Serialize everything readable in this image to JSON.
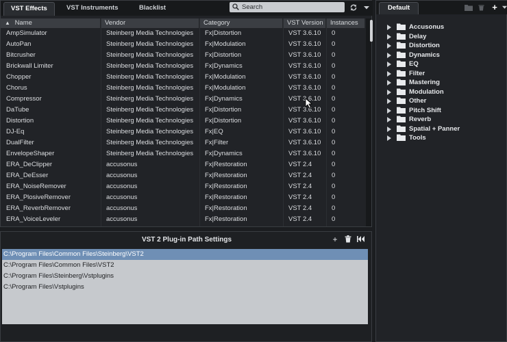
{
  "left_tabs": [
    "VST Effects",
    "VST Instruments",
    "Blacklist"
  ],
  "search": {
    "placeholder": "Search"
  },
  "toolbar": {
    "refresh_icon": "refresh-icon",
    "menu_icon": "dropdown-icon"
  },
  "table": {
    "sort_indicator": "▲",
    "columns": [
      "Name",
      "Vendor",
      "Category",
      "VST Version",
      "Instances"
    ],
    "rows": [
      [
        "AmpSimulator",
        "Steinberg Media Technologies",
        "Fx|Distortion",
        "VST 3.6.10",
        "0"
      ],
      [
        "AutoPan",
        "Steinberg Media Technologies",
        "Fx|Modulation",
        "VST 3.6.10",
        "0"
      ],
      [
        "Bitcrusher",
        "Steinberg Media Technologies",
        "Fx|Distortion",
        "VST 3.6.10",
        "0"
      ],
      [
        "Brickwall Limiter",
        "Steinberg Media Technologies",
        "Fx|Dynamics",
        "VST 3.6.10",
        "0"
      ],
      [
        "Chopper",
        "Steinberg Media Technologies",
        "Fx|Modulation",
        "VST 3.6.10",
        "0"
      ],
      [
        "Chorus",
        "Steinberg Media Technologies",
        "Fx|Modulation",
        "VST 3.6.10",
        "0"
      ],
      [
        "Compressor",
        "Steinberg Media Technologies",
        "Fx|Dynamics",
        "VST 3.6.10",
        "0"
      ],
      [
        "DaTube",
        "Steinberg Media Technologies",
        "Fx|Distortion",
        "VST 3.6.10",
        "0"
      ],
      [
        "Distortion",
        "Steinberg Media Technologies",
        "Fx|Distortion",
        "VST 3.6.10",
        "0"
      ],
      [
        "DJ-Eq",
        "Steinberg Media Technologies",
        "Fx|EQ",
        "VST 3.6.10",
        "0"
      ],
      [
        "DualFilter",
        "Steinberg Media Technologies",
        "Fx|Filter",
        "VST 3.6.10",
        "0"
      ],
      [
        "EnvelopeShaper",
        "Steinberg Media Technologies",
        "Fx|Dynamics",
        "VST 3.6.10",
        "0"
      ],
      [
        "ERA_DeClipper",
        "accusonus",
        "Fx|Restoration",
        "VST 2.4",
        "0"
      ],
      [
        "ERA_DeEsser",
        "accusonus",
        "Fx|Restoration",
        "VST 2.4",
        "0"
      ],
      [
        "ERA_NoiseRemover",
        "accusonus",
        "Fx|Restoration",
        "VST 2.4",
        "0"
      ],
      [
        "ERA_PlosiveRemover",
        "accusonus",
        "Fx|Restoration",
        "VST 2.4",
        "0"
      ],
      [
        "ERA_ReverbRemover",
        "accusonus",
        "Fx|Restoration",
        "VST 2.4",
        "0"
      ],
      [
        "ERA_VoiceLeveler",
        "accusonus",
        "Fx|Restoration",
        "VST 2.4",
        "0"
      ]
    ]
  },
  "path_settings": {
    "title": "VST 2 Plug-in Path Settings",
    "paths": [
      "C:\\Program Files\\Common Files\\Steinberg\\VST2",
      "C:\\Program Files\\Common Files\\VST2",
      "C:\\Program Files\\Steinberg\\Vstplugins",
      "C:\\Program Files\\Vstplugins"
    ],
    "selected_index": 0,
    "icons": [
      "add-icon",
      "trash-icon",
      "reset-icon"
    ]
  },
  "right_panel": {
    "tab": "Default",
    "icons": [
      "new-folder-icon",
      "trash-icon",
      "add-icon",
      "dropdown-icon"
    ],
    "folders": [
      "Accusonus",
      "Delay",
      "Distortion",
      "Dynamics",
      "EQ",
      "Filter",
      "Mastering",
      "Modulation",
      "Other",
      "Pitch Shift",
      "Reverb",
      "Spatial + Panner",
      "Tools"
    ]
  },
  "colors": {
    "selected_path": "#6f8fb5",
    "path_list_bg": "#c6c9cd",
    "panel_bg": "#212327"
  }
}
